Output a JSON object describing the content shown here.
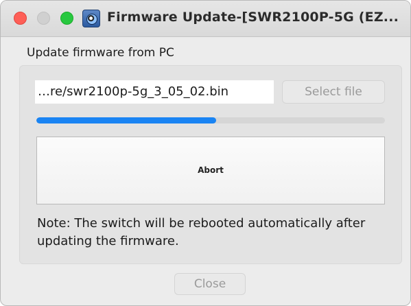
{
  "window": {
    "title": "Firmware Update-[SWR2100P-5G (EZ...",
    "traffic_lights": {
      "close_color": "#fe5f57",
      "minimize_color": "#d0d0d0",
      "zoom_color": "#28c840"
    },
    "app_icon": "camera-lens-icon"
  },
  "section": {
    "label": "Update firmware from PC"
  },
  "file": {
    "path_value": "…re/swr2100p-5g_3_05_02.bin",
    "select_button_label": "Select file"
  },
  "progress": {
    "value": 0.515,
    "color": "#1a84f3"
  },
  "abort_button_label": "Abort",
  "note": "Note: The switch will be rebooted automatically after updating the firmware.",
  "close_button_label": "Close"
}
